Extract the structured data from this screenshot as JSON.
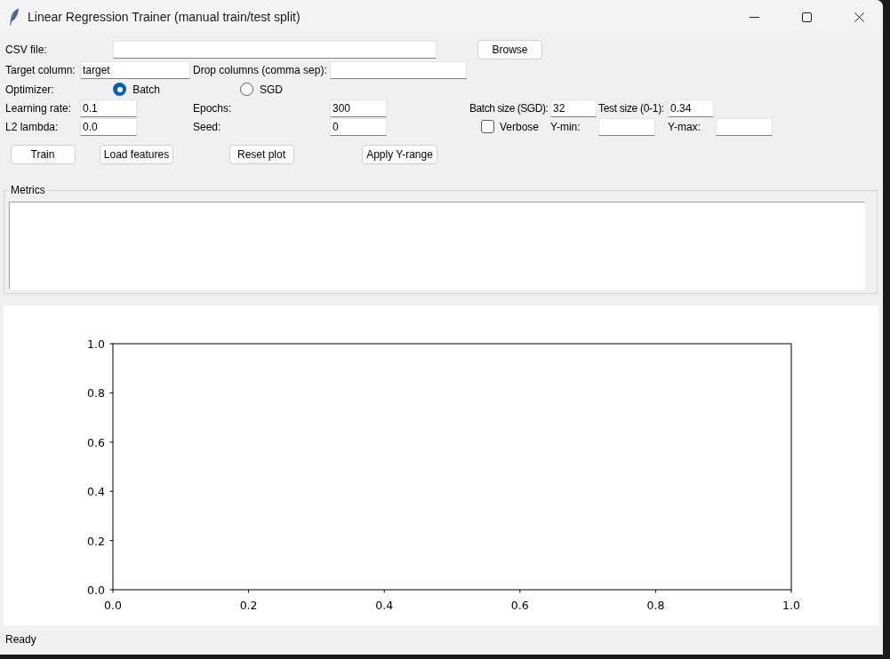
{
  "window": {
    "title": "Linear Regression Trainer (manual train/test split)"
  },
  "form": {
    "csv_file": {
      "label": "CSV file:"
    },
    "browse_button": {
      "label": "Browse"
    },
    "target_column": {
      "label": "Target column:",
      "value": "target"
    },
    "drop_columns": {
      "label": "Drop columns (comma sep):"
    },
    "optimizer": {
      "label": "Optimizer:",
      "options": [
        {
          "label": "Batch",
          "selected": true
        },
        {
          "label": "SGD",
          "selected": false
        }
      ]
    },
    "learning_rate": {
      "label": "Learning rate:",
      "value": "0.1"
    },
    "epochs": {
      "label": "Epochs:",
      "value": "300"
    },
    "batch_size": {
      "label": "Batch size (SGD):",
      "value": "32"
    },
    "test_size": {
      "label": "Test size (0-1):",
      "value": "0.34"
    },
    "l2_lambda": {
      "label": "L2 lambda:",
      "value": "0.0"
    },
    "seed": {
      "label": "Seed:",
      "value": "0"
    },
    "verbose": {
      "label": "Verbose",
      "checked": false
    },
    "y_min": {
      "label": "Y-min:"
    },
    "y_max": {
      "label": "Y-max:"
    }
  },
  "buttons": [
    "Train",
    "Load features",
    "Reset plot",
    "Apply Y-range"
  ],
  "metrics": {
    "title": "Metrics"
  },
  "plot": {
    "chart_data": [
      {
        "type": "line",
        "xlim": [
          0,
          1
        ],
        "ylim": [
          0,
          1
        ],
        "xticks": [
          {
            "value": 0,
            "label": "0.0"
          },
          {
            "value": 0.2,
            "label": "0.2"
          },
          {
            "value": 0.4,
            "label": "0.4"
          },
          {
            "value": 0.6,
            "label": "0.6"
          },
          {
            "value": 0.8,
            "label": "0.8"
          },
          {
            "value": 1,
            "label": "1.0"
          }
        ],
        "yticks": [
          {
            "value": 0,
            "label": "0.0"
          },
          {
            "value": 0.2,
            "label": "0.2"
          },
          {
            "value": 0.4,
            "label": "0.4"
          },
          {
            "value": 0.6,
            "label": "0.6"
          },
          {
            "value": 0.8,
            "label": "0.8"
          },
          {
            "value": 1,
            "label": "1.0"
          }
        ]
      }
    ]
  },
  "status_bar": {
    "text": "Ready"
  }
}
